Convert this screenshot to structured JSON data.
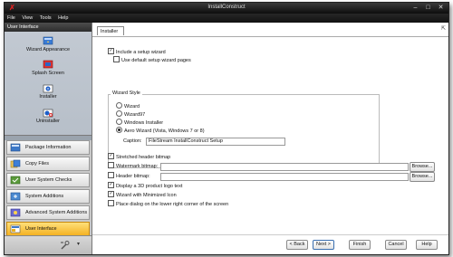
{
  "window": {
    "title": "InstallConstruct"
  },
  "menu": [
    "File",
    "View",
    "Tools",
    "Help"
  ],
  "sidebar": {
    "header": "User Interface",
    "items": [
      {
        "label": "Wizard Appearance"
      },
      {
        "label": "Splash Screen"
      },
      {
        "label": "Installer"
      },
      {
        "label": "Uninstaller"
      }
    ],
    "categories": [
      {
        "label": "Package Information"
      },
      {
        "label": "Copy Files"
      },
      {
        "label": "User System Checks"
      },
      {
        "label": "System Additions"
      },
      {
        "label": "Advanced System Additions"
      },
      {
        "label": "User Interface",
        "active": true
      }
    ]
  },
  "tab": {
    "label": "Installer"
  },
  "form": {
    "include_wizard": {
      "label": "Include a setup wizard",
      "checked": true
    },
    "default_pages": {
      "label": "Use default setup wizard pages",
      "checked": false
    },
    "wizard_style": {
      "title": "Wizard Style",
      "options": [
        "Wizard",
        "Wizard97",
        "Windows Installer",
        "Aero Wizard (Vista, Windows 7 or 8)"
      ],
      "selected": 3
    },
    "caption": {
      "label": "Caption:",
      "value": "FileStream InstallConstruct Setup"
    },
    "stretched_header": {
      "label": "Stretched header bitmap",
      "checked": true
    },
    "watermark": {
      "label": "Watermark bitmap:",
      "value": "",
      "checked": false
    },
    "header_bitmap": {
      "label": "Header bitmap:",
      "value": "",
      "checked": false
    },
    "logo_3d": {
      "label": "Display a 3D product logo text",
      "checked": true
    },
    "minimized_icon": {
      "label": "Wizard with Minimized Icon",
      "checked": true
    },
    "lower_right": {
      "label": "Place dialog on the lower right corner of the screen",
      "checked": false
    },
    "browse_label": "Browse..."
  },
  "nav": {
    "back": "< Back",
    "next": "Next >",
    "finish": "Finish",
    "cancel": "Cancel",
    "help": "Help"
  },
  "colors": {
    "active_category": "#f4b122",
    "titlebar": "#1a1a1a"
  }
}
